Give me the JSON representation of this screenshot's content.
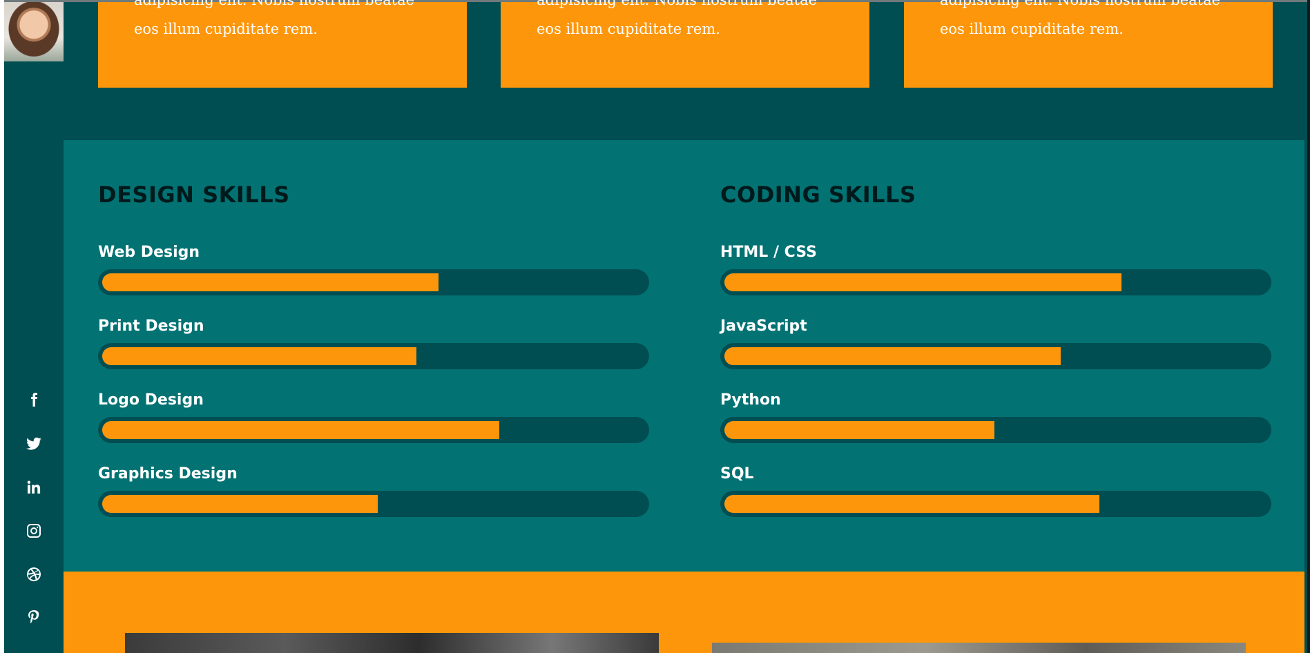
{
  "sidebar": {
    "avatar_alt": "profile photo",
    "social": [
      {
        "name": "facebook-icon"
      },
      {
        "name": "twitter-icon"
      },
      {
        "name": "linkedin-icon"
      },
      {
        "name": "instagram-icon"
      },
      {
        "name": "dribbble-icon"
      },
      {
        "name": "pinterest-icon"
      }
    ]
  },
  "services": {
    "cards": [
      {
        "line1": "adipisicing elit. Nobis nostrum beatae",
        "line2": "eos illum cupiditate rem."
      },
      {
        "line1": "adipisicing elit. Nobis nostrum beatae",
        "line2": "eos illum cupiditate rem."
      },
      {
        "line1": "adipisicing elit. Nobis nostrum beatae",
        "line2": "eos illum cupiditate rem."
      }
    ]
  },
  "skills": {
    "design": {
      "heading": "DESIGN SKILLS",
      "items": [
        {
          "label": "Web Design",
          "level": 0.61
        },
        {
          "label": "Print Design",
          "level": 0.57
        },
        {
          "label": "Logo Design",
          "level": 0.72
        },
        {
          "label": "Graphics Design",
          "level": 0.5
        }
      ]
    },
    "coding": {
      "heading": "CODING SKILLS",
      "items": [
        {
          "label": "HTML / CSS",
          "level": 0.72
        },
        {
          "label": "JavaScript",
          "level": 0.61
        },
        {
          "label": "Python",
          "level": 0.49
        },
        {
          "label": "SQL",
          "level": 0.68
        }
      ]
    }
  },
  "colors": {
    "dark_teal": "#014e52",
    "teal": "#027273",
    "orange": "#fe960b",
    "white": "#ffffff"
  }
}
